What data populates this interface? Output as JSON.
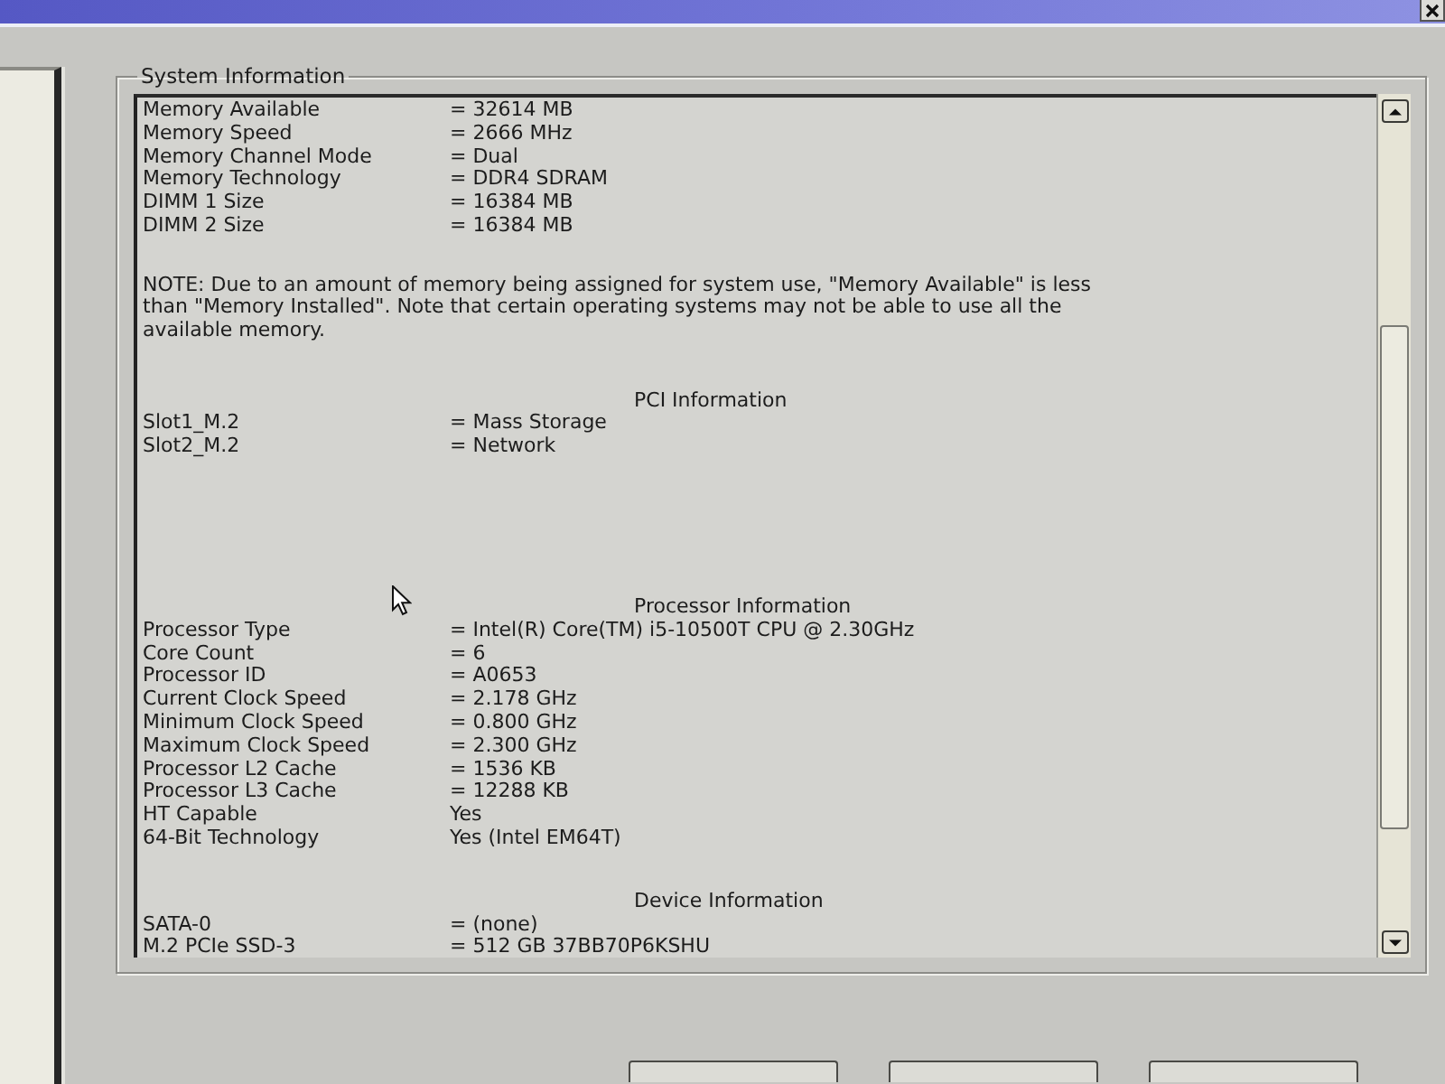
{
  "group_box": {
    "title": "System Information"
  },
  "sections": [
    {
      "kind": "rows",
      "rows": [
        {
          "label": "Memory Available",
          "value": "= 32614 MB"
        },
        {
          "label": "Memory Speed",
          "value": "= 2666 MHz"
        },
        {
          "label": "Memory Channel Mode",
          "value": "= Dual"
        },
        {
          "label": "Memory Technology",
          "value": "= DDR4 SDRAM"
        },
        {
          "label": "DIMM 1 Size",
          "value": "= 16384 MB"
        },
        {
          "label": "DIMM 2 Size",
          "value": "= 16384 MB"
        }
      ]
    },
    {
      "kind": "note",
      "text": "NOTE: Due to an amount of memory being assigned for system use, \"Memory Available\" is less than \"Memory Installed\". Note that certain operating systems may not be able to use all the available memory."
    },
    {
      "kind": "rows",
      "heading": "PCI Information",
      "rows": [
        {
          "label": "Slot1_M.2",
          "value": "= Mass Storage"
        },
        {
          "label": "Slot2_M.2",
          "value": "= Network"
        }
      ]
    },
    {
      "kind": "rows",
      "heading": "Processor Information",
      "rows": [
        {
          "label": "Processor Type",
          "value": "= Intel(R) Core(TM) i5-10500T CPU @ 2.30GHz"
        },
        {
          "label": "Core Count",
          "value": "= 6"
        },
        {
          "label": "Processor ID",
          "value": "= A0653"
        },
        {
          "label": "Current Clock Speed",
          "value": "= 2.178 GHz"
        },
        {
          "label": "Minimum Clock Speed",
          "value": "= 0.800 GHz"
        },
        {
          "label": "Maximum Clock Speed",
          "value": "= 2.300 GHz"
        },
        {
          "label": "Processor L2 Cache",
          "value": "= 1536 KB"
        },
        {
          "label": "Processor L3 Cache",
          "value": "= 12288 KB"
        },
        {
          "label": "HT Capable",
          "value": "Yes"
        },
        {
          "label": "64-Bit Technology",
          "value": "Yes (Intel EM64T)"
        }
      ]
    },
    {
      "kind": "rows",
      "heading": "Device Information",
      "rows": [
        {
          "label": "SATA-0",
          "value": "= (none)"
        },
        {
          "label": "M.2 PCIe SSD-3",
          "value": "= 512 GB 37BB70P6KSHU"
        }
      ]
    }
  ]
}
